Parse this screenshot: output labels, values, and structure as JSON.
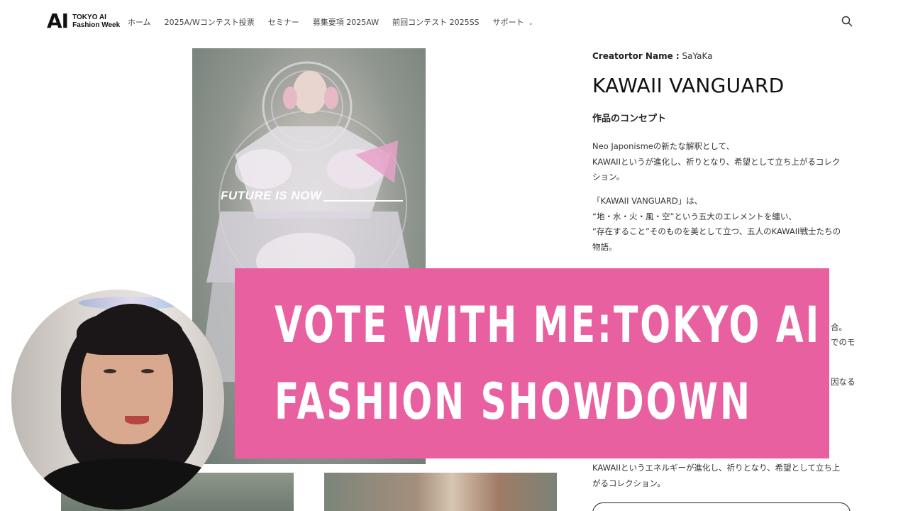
{
  "header": {
    "logo_mark": "AI",
    "logo_line1": "TOKYO AI",
    "logo_line2": "Fashion Week",
    "nav": [
      "ホーム",
      "2025A/Wコンテスト投票",
      "セミナー",
      "募集要項 2025AW",
      "前回コンテスト 2025SS",
      "サポート"
    ]
  },
  "main_image": {
    "overlay_text": "FUTURE IS NOW"
  },
  "detail": {
    "creator_label": "Creatortor Name :",
    "creator_value": "SaYaKa",
    "title": "KAWAII VANGUARD",
    "concept_heading": "作品のコンセプト",
    "para1": "Neo Japonismeの新たな解釈として、\nKAWAIIというが進化し、祈りとなり、希望として立ち上がるコレクション。",
    "para2": "「KAWAII VANGUARD」は、\n“地・水・火・風・空”という五大のエレメントを纏い、\n“存在すること”そのものを美として立つ、五人のKAWAII戦士たちの物語。",
    "frag1": "合。",
    "frag2": "でのモ",
    "frag3": "因なる",
    "para3": "KAWAIIというエネルギーが進化し、祈りとなり、希望として立ち上がるコレクション。"
  },
  "banner": {
    "line1": "VOTE WITH ME:TOKYO AI",
    "line2": "FASHION SHOWDOWN"
  }
}
